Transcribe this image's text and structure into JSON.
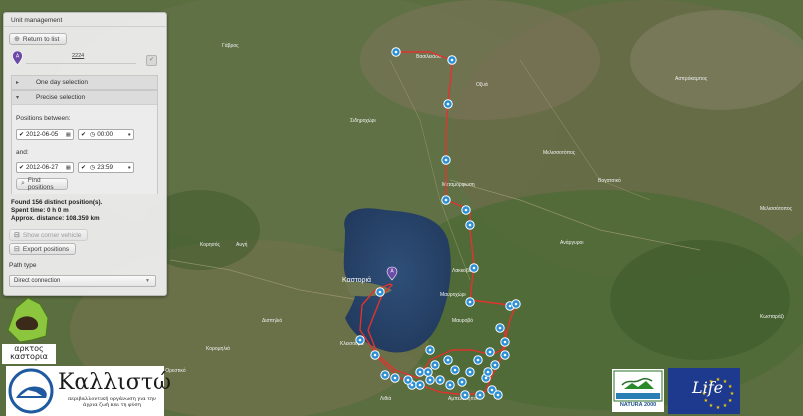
{
  "panel": {
    "title": "Unit management",
    "return_label": "Return to list",
    "unit_id": "2224",
    "one_day_label": "One day selection",
    "precise_label": "Precise selection",
    "positions_between_label": "Positions between:",
    "and_label": "and:",
    "start_date": "2012-06-05",
    "start_time": "00:00",
    "end_date": "2012-06-27",
    "end_time": "23:59",
    "find_label": "Find positions",
    "found_text": "Found 156 distinct position(s).",
    "spent_text": "Spent time: 0 h 0 m",
    "distance_text": "Approx. distance: 108.359 km",
    "show_corner_label": "Show corner vehicle",
    "export_label": "Export positions",
    "path_type_label": "Path type",
    "path_type_value": "Direct connection"
  },
  "map": {
    "labels": [
      "Γάβρος",
      "Βασιλειάδα",
      "Οξυά",
      "Σιδηροχώρι",
      "Μεταμόρφωση",
      "Μελισσοτόπος",
      "Βογατσικό",
      "Κορησός",
      "Ανάργυροι",
      "Καστοριά",
      "Λακκοβίκια",
      "Μαυροχώρι",
      "Μαυροβό",
      "Δισπηλιό",
      "Κορομηλιά",
      "Άργος Ορεστικό",
      "Αυγή",
      "Μελισσότοπος",
      "Κωσταράζι",
      "Ασπρόκαμπος",
      "Κλεισούρα",
      "Λιθιά",
      "Αμπελοκήποι"
    ],
    "track_color": "#e0332e",
    "marker_color": "#2b8fd6",
    "highlight_marker_color": "#6b4aa8"
  },
  "logos": {
    "arktos": "αρκτος καστορια",
    "kallisto": "Καλλιστώ",
    "kallisto_sub": "περιβαλλοντική οργάνωση για την άγρια ζωή και τη φύση",
    "natura": "NATURA 2000",
    "life": "Life"
  }
}
